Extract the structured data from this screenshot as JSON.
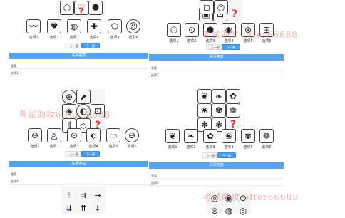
{
  "watermarks": {
    "site": "考试助攻",
    "qq": "offer66688",
    "blue": "网"
  },
  "question_a": {
    "options": [
      "选项1",
      "选项2",
      "选项3",
      "选项4",
      "选项5",
      "选项6"
    ],
    "prev": "上一题",
    "next": "下一题",
    "bar_label": "关闭答案",
    "answer_label": "答案",
    "answer_value": "选项1"
  },
  "question_b": {
    "options": [
      "选项1",
      "选项2",
      "选项3",
      "选项4",
      "选项5",
      "选项6"
    ],
    "prev": "上一题",
    "next": "下一题",
    "bar_label": "关闭答案",
    "answer_label": "答案",
    "answer_value": "选项2"
  },
  "question_c": {
    "options": [
      "选项1",
      "选项2",
      "选项3",
      "选项4",
      "选项5",
      "选项6"
    ],
    "prev": "上一题",
    "next": "下一题",
    "bar_label": "关闭答案",
    "answer_label": "答案",
    "answer_value": "选项4"
  },
  "question_d": {
    "options": [
      "选项1",
      "选项2",
      "选项3",
      "选项4",
      "选项5",
      "选项6"
    ],
    "prev": "上一题",
    "next": "下一题",
    "bar_label": "关闭答案",
    "answer_label": "答案",
    "answer_value": "选项5"
  },
  "question_mark": "?"
}
